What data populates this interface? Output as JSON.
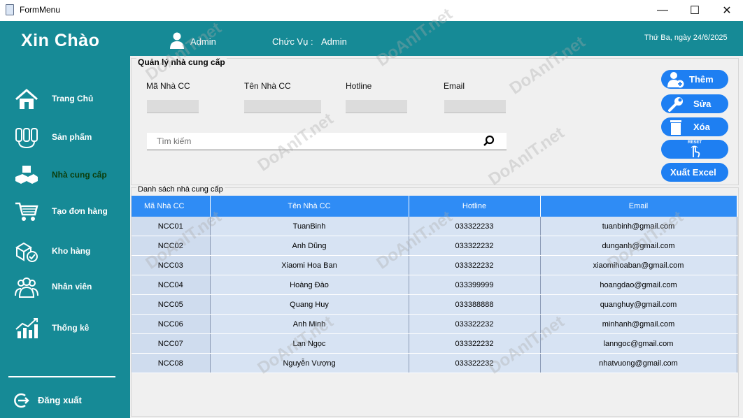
{
  "window": {
    "title": "FormMenu",
    "minimize": "—",
    "maximize": "☐",
    "close": "✕"
  },
  "header": {
    "greeting": "Xin Chào",
    "user": "Admin",
    "role_label": "Chức Vụ :",
    "role_value": "Admin",
    "date": "Thứ Ba, ngày 24/6/2025"
  },
  "sidebar": {
    "items": [
      {
        "label": "Trang Chủ",
        "icon": "home-icon"
      },
      {
        "label": "Sản phẩm",
        "icon": "product-icon"
      },
      {
        "label": "Nhà cung cấp",
        "icon": "handshake-icon"
      },
      {
        "label": "Tạo đơn hàng",
        "icon": "cart-icon"
      },
      {
        "label": "Kho hàng",
        "icon": "warehouse-icon"
      },
      {
        "label": "Nhân viên",
        "icon": "staff-icon"
      },
      {
        "label": "Thống kê",
        "icon": "chart-icon"
      }
    ],
    "active_index": 2,
    "logout": "Đăng xuất"
  },
  "form": {
    "title": "Quản lý nhà cung cấp",
    "fields": [
      {
        "label": "Mã Nhà CC",
        "value": ""
      },
      {
        "label": "Tên Nhà CC",
        "value": ""
      },
      {
        "label": "Hotline",
        "value": ""
      },
      {
        "label": "Email",
        "value": ""
      }
    ],
    "search_placeholder": "Tìm kiếm"
  },
  "buttons": {
    "add": "Thêm",
    "edit": "Sửa",
    "delete": "Xóa",
    "reset": "RESET",
    "export": "Xuất Excel"
  },
  "list": {
    "title": "Danh sách nhà cung cấp",
    "columns": [
      "Mã Nhà CC",
      "Tên Nhà CC",
      "Hotline",
      "Email"
    ],
    "rows": [
      [
        "NCC01",
        "TuanBinh",
        "033322233",
        "tuanbinh@gmail.com"
      ],
      [
        "NCC02",
        "Anh Dũng",
        "033322232",
        "dunganh@gmail.com"
      ],
      [
        "NCC03",
        "Xiaomi Hoa Ban",
        "033322232",
        "xiaomihoaban@gmail.com"
      ],
      [
        "NCC04",
        "Hoàng Đào",
        "033399999",
        "hoangdao@gmail.com"
      ],
      [
        "NCC05",
        "Quang Huy",
        "033388888",
        "quanghuy@gmail.com"
      ],
      [
        "NCC06",
        "Anh Minh",
        "033322232",
        "minhanh@gmail.com"
      ],
      [
        "NCC07",
        "Lan Ngọc",
        "033322232",
        "lanngoc@gmail.com"
      ],
      [
        "NCC08",
        "Nguyễn Vượng",
        "033322232",
        "nhatvuong@gmail.com"
      ]
    ]
  },
  "watermark": "DoAnIT.net",
  "colors": {
    "teal": "#168a96",
    "button_blue": "#1e7ff2",
    "header_blue": "#2f8cf5",
    "row_bg": "#d7e3f3"
  }
}
